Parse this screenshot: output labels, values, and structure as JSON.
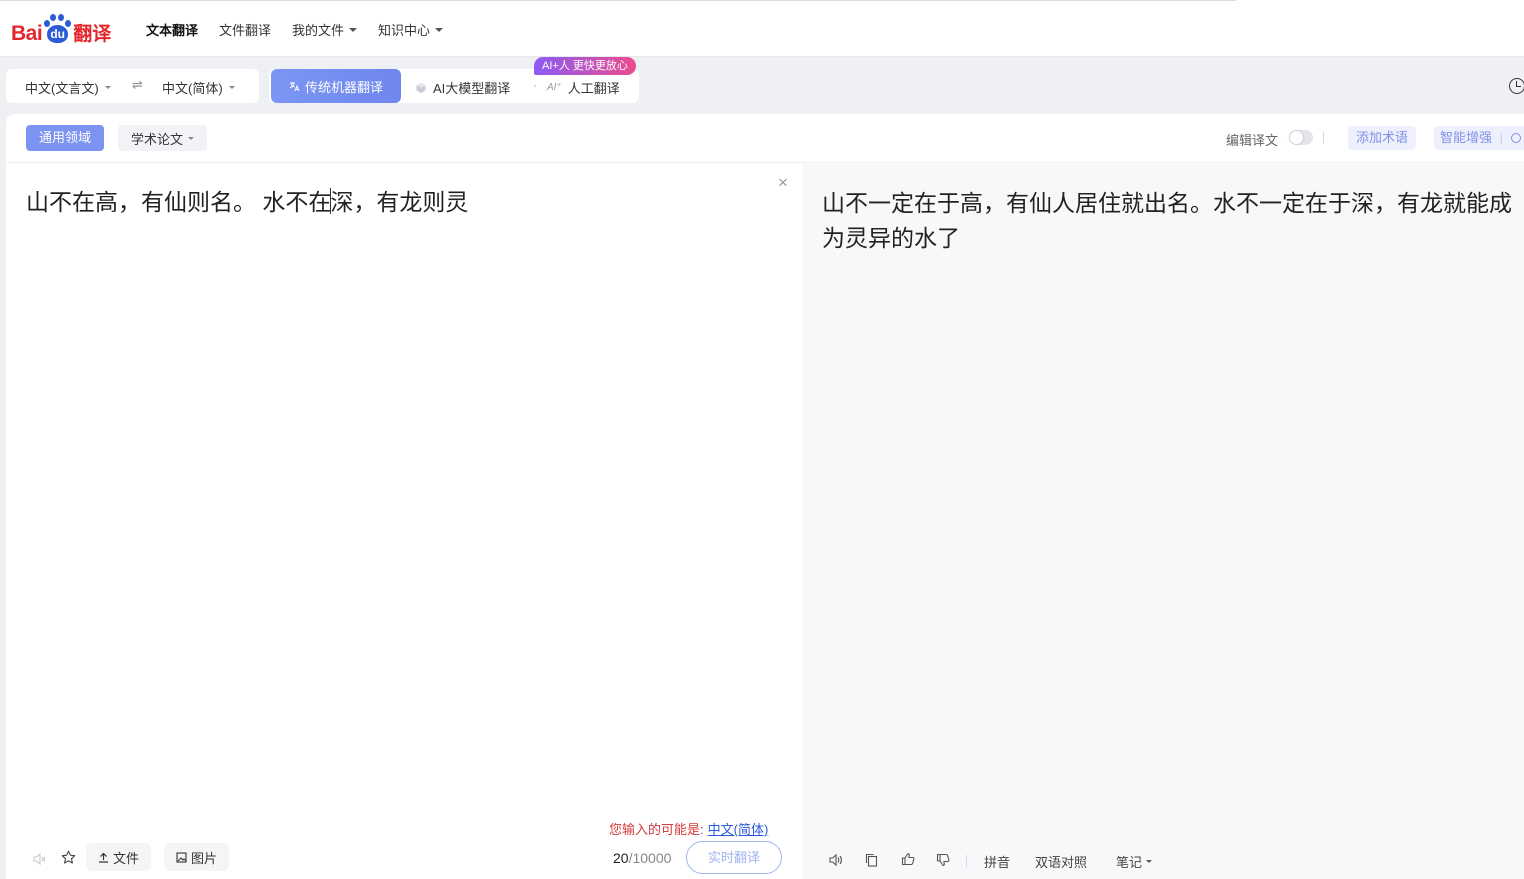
{
  "brand": {
    "logo_left": "Bai",
    "logo_paw": "du",
    "logo_right": "翻译"
  },
  "nav": {
    "items": [
      {
        "label": "文本翻译",
        "active": true,
        "dropdown": false
      },
      {
        "label": "文件翻译",
        "active": false,
        "dropdown": false
      },
      {
        "label": "我的文件",
        "active": false,
        "dropdown": true
      },
      {
        "label": "知识中心",
        "active": false,
        "dropdown": true
      }
    ]
  },
  "languages": {
    "source": "中文(文言文)",
    "swap_symbol": "⇌",
    "target": "中文(简体)"
  },
  "modes": {
    "traditional": "传统机器翻译",
    "ai_model": "AI大模型翻译",
    "separator": "·",
    "ai_mark": "AI⁺",
    "human": "人工翻译",
    "promo_badge": "AI+人 更快更放心"
  },
  "domains": {
    "active": "通用领域",
    "other": "学术论文"
  },
  "editor_tools": {
    "edit_label": "编辑译文",
    "add_term": "添加术语",
    "smart_enhance": "智能增强",
    "smart_sep": "|"
  },
  "source": {
    "text_before_cursor": "山不在高，有仙则名。 水不在",
    "text_after_cursor": "深，有龙则灵",
    "clear_symbol": "×",
    "detect_prefix": "您输入的可能是:",
    "detect_language": "中文(简体)",
    "char_count": "20",
    "char_limit": "/10000",
    "file_label": "文件",
    "image_label": "图片",
    "translate_button": "实时翻译"
  },
  "target": {
    "text": "山不一定在于高，有仙人居住就出名。水不一定在于深，有龙就能成为灵异的水了",
    "pinyin": "拼音",
    "bilingual": "双语对照",
    "notes": "笔记"
  },
  "colors": {
    "brand_red": "#e4252c",
    "brand_blue": "#2b5bd7",
    "accent": "#7d93f2"
  }
}
